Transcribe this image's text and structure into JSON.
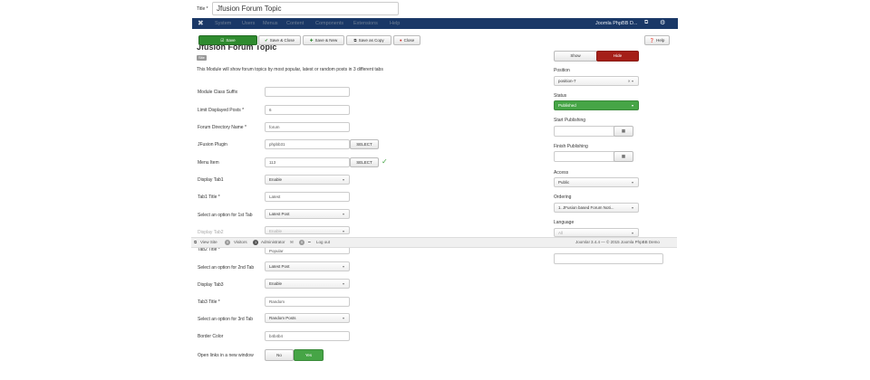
{
  "title_field": {
    "label": "Title *",
    "value": "Jfusion Forum Topic"
  },
  "navbar": {
    "items": [
      "System",
      "Users",
      "Menus",
      "Content",
      "Components",
      "Extensions",
      "Help"
    ],
    "site_name": "Joomla PhpBB D...",
    "external_icon": "external-link-icon",
    "settings_icon": "gear-icon",
    "logo_icon": "joomla-logo-icon"
  },
  "toolbar": {
    "save": "Save",
    "save_close": "Save & Close",
    "save_new": "Save & New",
    "save_copy": "Save as Copy",
    "close": "Close",
    "help": "Help"
  },
  "module": {
    "heading": "Jfusion Forum Topic",
    "badge": "Site",
    "description": "This Module will show forum topics by most popular, latest or random posts in 3 different tabs"
  },
  "form": {
    "module_class_suffix": {
      "label": "Module Class Suffix",
      "value": ""
    },
    "limit_displayed_posts": {
      "label": "Limit Displayed Posts *",
      "value": "6"
    },
    "forum_directory_name": {
      "label": "Forum Directory Name *",
      "value": "forum"
    },
    "jfusion_plugin": {
      "label": "JFusion Plugin",
      "value": "phpbb31",
      "button": "SELECT"
    },
    "menu_item": {
      "label": "Menu Item",
      "value": "113",
      "button": "SELECT"
    },
    "display_tab1": {
      "label": "Display Tab1",
      "value": "Enable"
    },
    "tab1_title": {
      "label": "Tab1 Title *",
      "value": "Latest"
    },
    "option_tab1": {
      "label": "Select an option for 1st Tab",
      "value": "Latest Post"
    },
    "display_tab2": {
      "label": "Display Tab2",
      "value": "Enable"
    },
    "tab2_title": {
      "label": "Tab2 Title *",
      "value": "Popular"
    },
    "option_tab2": {
      "label": "Select an option for 2nd Tab",
      "value": "Latest Post"
    },
    "display_tab3": {
      "label": "Display Tab3",
      "value": "Enable"
    },
    "tab3_title": {
      "label": "Tab3 Title *",
      "value": "Random"
    },
    "option_tab3": {
      "label": "Select an option for 3rd Tab",
      "value": "Random Posts"
    },
    "border_color": {
      "label": "Border Color",
      "value": "b4b4b4"
    },
    "open_links": {
      "label": "Open links in a new window",
      "no": "No",
      "yes": "Yes"
    }
  },
  "sidebar": {
    "show": "Show",
    "hide": "Hide",
    "position": {
      "label": "Position",
      "value": "position-7"
    },
    "status": {
      "label": "Status",
      "value": "Published"
    },
    "start_publishing": {
      "label": "Start Publishing"
    },
    "finish_publishing": {
      "label": "Finish Publishing"
    },
    "access": {
      "label": "Access",
      "value": "Public"
    },
    "ordering": {
      "label": "Ordering",
      "value": "1. JFusion based Forum Noti..."
    },
    "language": {
      "label": "Language",
      "value": "All"
    },
    "note": {
      "label": "Note",
      "value": ""
    }
  },
  "statusbar": {
    "view_site": "View Site",
    "visitors_count": "0",
    "visitors": "Visitors",
    "admin_count": "1",
    "administrator": "Administrator",
    "messages_count": "0",
    "logout": "Log out",
    "copyright": "Joomla! 3.4.4 — © 2015 Joomla PhpBB Demo"
  },
  "colors": {
    "navbar_bg": "#1a3867",
    "save_green": "#2f8b2f",
    "published_green": "#46a546",
    "hide_red": "#a51f18",
    "close_icon_red": "#c9302c"
  }
}
